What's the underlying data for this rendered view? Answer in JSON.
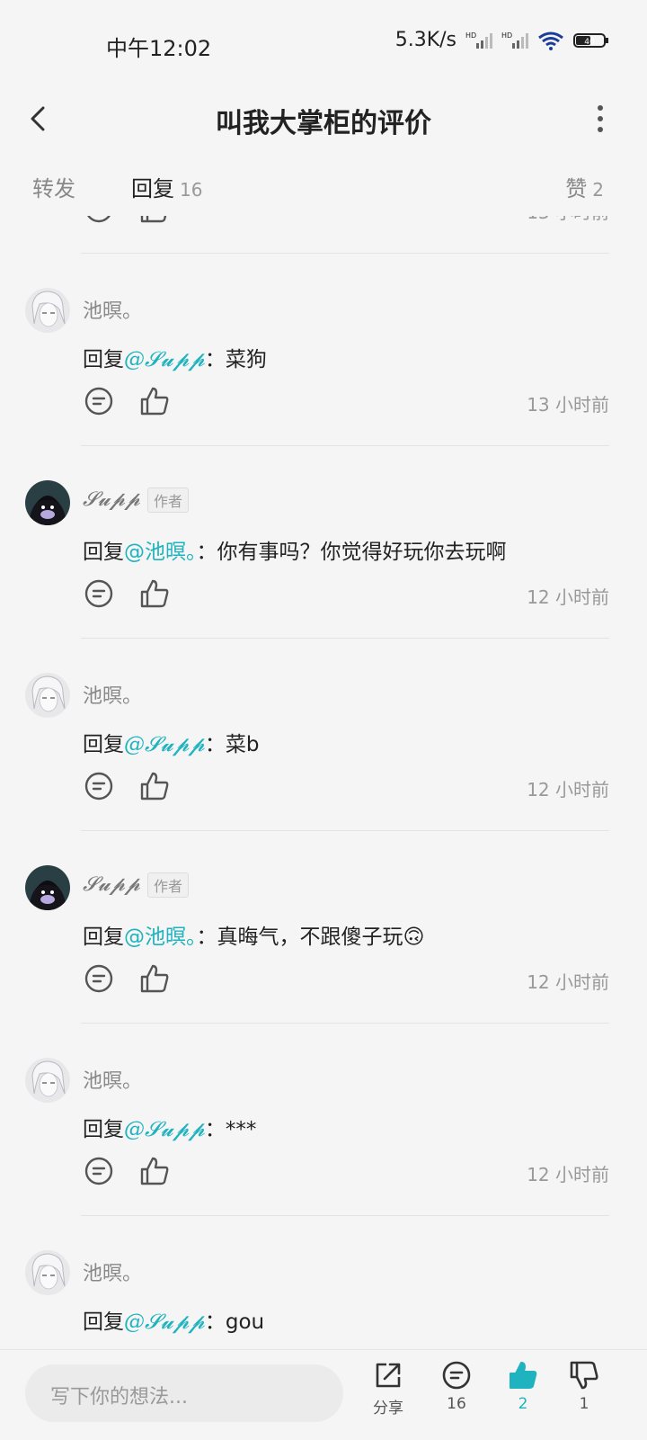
{
  "status": {
    "time": "中午12:02",
    "speed": "5.3K/s",
    "battery": "46"
  },
  "header": {
    "title": "叫我大掌柜的评价"
  },
  "tabs": [
    {
      "label": "转发",
      "count": ""
    },
    {
      "label": "回复",
      "count": "16"
    },
    {
      "label": "赞",
      "count": "2"
    }
  ],
  "top_partial": {
    "time": "13 小时前"
  },
  "comments": [
    {
      "user": "池暝。",
      "is_author": false,
      "reply_prefix": "回复",
      "mention": "@𝓢𝓾𝓹𝓹",
      "text": "：菜狗",
      "time": "13 小时前"
    },
    {
      "user": "𝓢𝓾𝓹𝓹",
      "is_author": true,
      "badge": "作者",
      "reply_prefix": "回复",
      "mention": "@池暝。",
      "text": "：你有事吗？你觉得好玩你去玩啊",
      "time": "12 小时前"
    },
    {
      "user": "池暝。",
      "is_author": false,
      "reply_prefix": "回复",
      "mention": "@𝓢𝓾𝓹𝓹",
      "text": "：菜b",
      "time": "12 小时前"
    },
    {
      "user": "𝓢𝓾𝓹𝓹",
      "is_author": true,
      "badge": "作者",
      "reply_prefix": "回复",
      "mention": "@池暝。",
      "text": "：真晦气，不跟傻子玩🙃",
      "time": "12 小时前"
    },
    {
      "user": "池暝。",
      "is_author": false,
      "reply_prefix": "回复",
      "mention": "@𝓢𝓾𝓹𝓹",
      "text": "：***",
      "time": "12 小时前"
    },
    {
      "user": "池暝。",
      "is_author": false,
      "reply_prefix": "回复",
      "mention": "@𝓢𝓾𝓹𝓹",
      "text": "：gou",
      "time": ""
    }
  ],
  "bottom": {
    "input_placeholder": "写下你的想法...",
    "share_label": "分享",
    "comment_count": "16",
    "like_count": "2",
    "dislike_count": "1"
  },
  "colors": {
    "accent": "#1fb3bf",
    "background": "#f5f5f5"
  },
  "icons": [
    "back-icon",
    "more-icon",
    "comment-icon",
    "like-icon",
    "share-icon",
    "dislike-icon",
    "wifi-icon",
    "signal-icon",
    "battery-icon"
  ]
}
